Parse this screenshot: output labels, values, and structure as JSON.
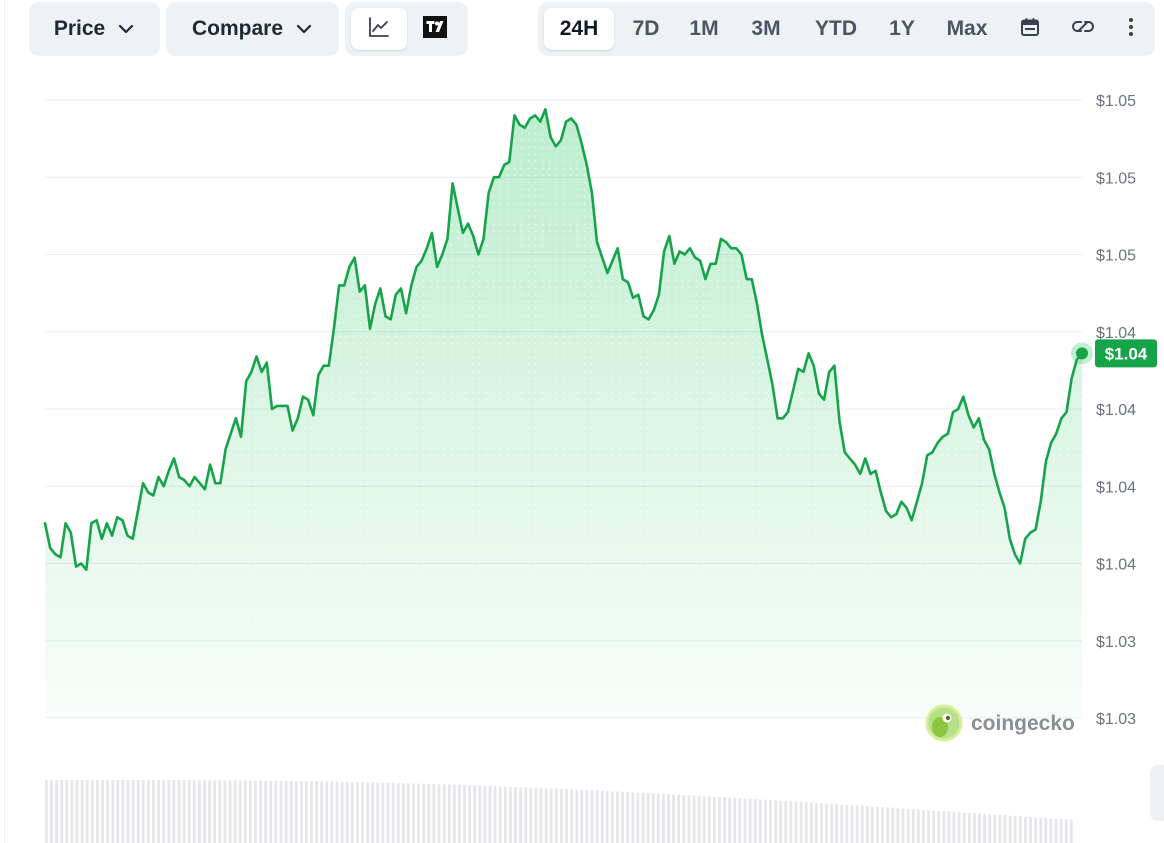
{
  "toolbar": {
    "price_label": "Price",
    "compare_label": "Compare",
    "view_modes": [
      "line-chart-icon",
      "tradingview-icon"
    ],
    "ranges": [
      "24H",
      "7D",
      "1M",
      "3M",
      "YTD",
      "1Y",
      "Max"
    ],
    "active_range": "24H",
    "extra_icons": [
      "calendar-icon",
      "link-icon",
      "more-vertical-icon"
    ]
  },
  "chart_data": {
    "type": "area",
    "y_tick_labels": [
      "$1.05",
      "$1.05",
      "$1.05",
      "$1.04",
      "$1.04",
      "$1.04",
      "$1.04",
      "$1.03",
      "$1.03"
    ],
    "ylim": [
      1.03,
      1.05
    ],
    "current_price_label": "$1.04",
    "watermark": "coingecko",
    "grid": true,
    "series": [
      {
        "color": "#16a34a",
        "fill_color": "#dcf5e4",
        "values": [
          1.0363,
          1.0355,
          1.0353,
          1.0352,
          1.0363,
          1.036,
          1.0349,
          1.035,
          1.0348,
          1.0363,
          1.0364,
          1.0358,
          1.0363,
          1.0359,
          1.0365,
          1.0364,
          1.0359,
          1.0358,
          1.0367,
          1.0376,
          1.0373,
          1.0372,
          1.0378,
          1.0375,
          1.038,
          1.0384,
          1.0378,
          1.0377,
          1.0375,
          1.0378,
          1.0376,
          1.0374,
          1.0382,
          1.0376,
          1.0376,
          1.0387,
          1.0392,
          1.0397,
          1.0391,
          1.0409,
          1.0412,
          1.0417,
          1.0412,
          1.0415,
          1.04,
          1.0401,
          1.0401,
          1.0401,
          1.0393,
          1.0397,
          1.0404,
          1.0403,
          1.0398,
          1.0411,
          1.0414,
          1.0414,
          1.0426,
          1.044,
          1.044,
          1.0446,
          1.0449,
          1.0438,
          1.044,
          1.0426,
          1.0434,
          1.0439,
          1.043,
          1.0429,
          1.0437,
          1.0439,
          1.0431,
          1.044,
          1.0446,
          1.0448,
          1.0452,
          1.0457,
          1.0446,
          1.045,
          1.0455,
          1.0473,
          1.0465,
          1.0457,
          1.046,
          1.0456,
          1.045,
          1.0455,
          1.047,
          1.0475,
          1.0475,
          1.0479,
          1.048,
          1.0495,
          1.0492,
          1.0491,
          1.0494,
          1.0495,
          1.0493,
          1.0497,
          1.0488,
          1.0485,
          1.0487,
          1.0493,
          1.0494,
          1.0492,
          1.0486,
          1.0479,
          1.047,
          1.0454,
          1.0449,
          1.0444,
          1.0448,
          1.0452,
          1.0442,
          1.0441,
          1.0436,
          1.0437,
          1.043,
          1.0429,
          1.0432,
          1.0437,
          1.0451,
          1.0456,
          1.0447,
          1.0451,
          1.045,
          1.0452,
          1.0449,
          1.0448,
          1.0442,
          1.0447,
          1.0447,
          1.0455,
          1.0454,
          1.0452,
          1.0452,
          1.045,
          1.0442,
          1.0442,
          1.0434,
          1.0424,
          1.0416,
          1.0408,
          1.0397,
          1.0397,
          1.0399,
          1.0406,
          1.0413,
          1.0412,
          1.0418,
          1.0414,
          1.0405,
          1.0403,
          1.0412,
          1.0414,
          1.0396,
          1.0386,
          1.0384,
          1.0382,
          1.0379,
          1.0384,
          1.0379,
          1.038,
          1.0373,
          1.0367,
          1.0365,
          1.0366,
          1.037,
          1.0368,
          1.0364,
          1.037,
          1.0376,
          1.0385,
          1.0386,
          1.0389,
          1.0391,
          1.0392,
          1.0399,
          1.04,
          1.0404,
          1.0398,
          1.0394,
          1.0397,
          1.039,
          1.0387,
          1.0379,
          1.0373,
          1.0368,
          1.0358,
          1.0353,
          1.035,
          1.0358,
          1.036,
          1.0361,
          1.037,
          1.0383,
          1.0389,
          1.0392,
          1.0397,
          1.0399,
          1.041,
          1.0416,
          1.0418
        ],
        "volume_values": [
          100,
          100,
          100,
          100,
          100,
          100,
          100,
          100,
          100,
          100,
          100,
          100,
          100,
          100,
          100,
          100,
          100,
          100,
          100,
          100,
          100,
          100,
          100,
          100,
          100,
          100,
          100,
          100,
          100,
          100,
          99,
          99,
          99,
          99,
          99,
          99,
          99,
          99,
          99,
          99,
          98,
          98,
          98,
          98,
          98,
          98,
          98,
          98,
          97,
          97,
          97,
          97,
          97,
          97,
          96,
          96,
          96,
          96,
          95,
          95,
          95,
          95,
          95,
          94,
          94,
          94,
          93,
          93,
          93,
          92,
          92,
          92,
          91,
          91,
          91,
          90,
          90,
          89,
          89,
          89,
          88,
          88,
          87,
          87,
          87,
          86,
          86,
          85,
          85,
          84,
          84,
          83,
          83,
          82,
          82,
          81,
          81,
          80,
          80,
          79,
          79,
          78,
          78,
          77,
          76,
          76,
          75,
          75,
          74,
          74,
          73,
          72,
          72,
          71,
          70,
          70,
          69,
          69,
          68,
          67,
          67,
          66,
          65,
          65,
          64,
          63,
          63,
          62,
          61,
          60,
          60,
          59,
          58,
          58,
          57,
          56,
          55,
          55,
          54,
          53,
          52,
          52,
          51,
          50,
          49,
          49,
          48,
          47,
          46,
          45,
          45,
          44,
          43,
          42,
          42,
          41,
          40,
          39,
          38,
          38,
          37,
          36,
          35,
          34,
          33,
          33,
          32,
          31,
          30,
          29,
          29,
          28,
          27,
          26,
          25,
          24,
          24,
          23,
          22,
          21,
          20,
          20,
          19,
          18,
          17,
          16,
          15,
          15,
          14,
          13,
          12,
          11,
          10,
          10,
          9,
          8,
          7,
          6,
          5,
          5,
          4,
          3
        ]
      }
    ]
  }
}
